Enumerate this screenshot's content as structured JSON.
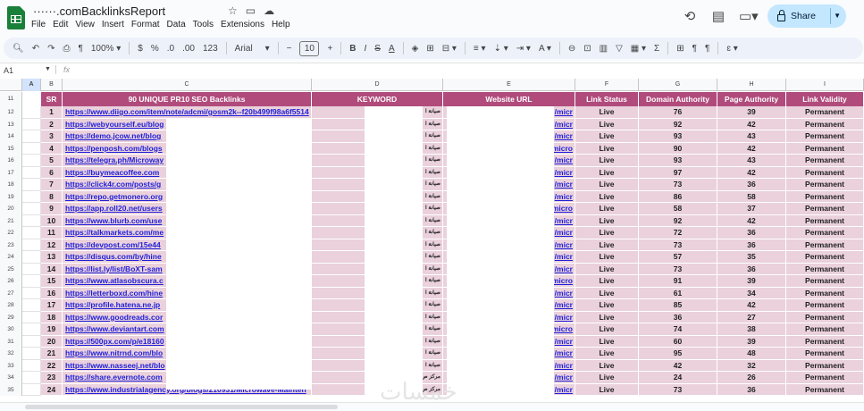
{
  "app": {
    "doc_title": "······.comBacklinksReport",
    "menu": [
      "File",
      "Edit",
      "View",
      "Insert",
      "Format",
      "Data",
      "Tools",
      "Extensions",
      "Help"
    ],
    "share_label": "Share",
    "title_icons": [
      "star-icon",
      "folder-move-icon",
      "cloud-status-icon"
    ],
    "top_right_icons": [
      "history-icon",
      "comment-icon",
      "video-meet-icon"
    ]
  },
  "toolbar": {
    "zoom": "100%",
    "currency": "$",
    "percent": "%",
    "dec_less": ".0",
    "dec_more": ".00",
    "number_format": "123",
    "font": "Arial",
    "font_size": "10",
    "minus": "−",
    "plus": "+"
  },
  "formula_bar": {
    "cell_ref": "A1",
    "fx": "fx"
  },
  "columns": [
    "A",
    "B",
    "C",
    "D",
    "E",
    "F",
    "G",
    "H",
    "I"
  ],
  "headers": {
    "sr": "SR",
    "backlinks": "90 UNIQUE PR10 SEO Backlinks",
    "keyword": "KEYWORD",
    "website": "Website URL",
    "status": "Link Status",
    "da": "Domain Authority",
    "pa": "Page Authority",
    "validity": "Link Validity"
  },
  "header_row_num": "11",
  "rows": [
    {
      "n": "12",
      "sr": "1",
      "url": "https://www.diigo.com/item/note/adcmi/gosm2k--f20b499f98a6f5514",
      "kw": "صيانة ا",
      "site": "/micr",
      "status": "Live",
      "da": "76",
      "pa": "39",
      "valid": "Permanent"
    },
    {
      "n": "13",
      "sr": "2",
      "url": "https://webyourself.eu/blog",
      "kw": "صيانة ا",
      "site": "/micr",
      "status": "Live",
      "da": "92",
      "pa": "42",
      "valid": "Permanent"
    },
    {
      "n": "14",
      "sr": "3",
      "url": "https://demo.jcow.net/blog",
      "kw": "صيانة ا",
      "site": "/micr",
      "status": "Live",
      "da": "93",
      "pa": "43",
      "valid": "Permanent"
    },
    {
      "n": "15",
      "sr": "4",
      "url": "https://penposh.com/blogs",
      "kw": "صيانة ا",
      "site": "/micro",
      "status": "Live",
      "da": "90",
      "pa": "42",
      "valid": "Permanent"
    },
    {
      "n": "16",
      "sr": "5",
      "url": "https://telegra.ph/Microway",
      "kw": "صيانة ا",
      "site": "/micr",
      "status": "Live",
      "da": "93",
      "pa": "43",
      "valid": "Permanent"
    },
    {
      "n": "17",
      "sr": "6",
      "url": "https://buymeacoffee.com",
      "kw": "صيانة ا",
      "site": "/micr",
      "status": "Live",
      "da": "97",
      "pa": "42",
      "valid": "Permanent"
    },
    {
      "n": "18",
      "sr": "7",
      "url": "https://click4r.com/posts/g",
      "kw": "صيانة ا",
      "site": "/micr",
      "status": "Live",
      "da": "73",
      "pa": "36",
      "valid": "Permanent"
    },
    {
      "n": "19",
      "sr": "8",
      "url": "https://repo.getmonero.org",
      "kw": "صيانة ا",
      "site": "/micr",
      "status": "Live",
      "da": "86",
      "pa": "58",
      "valid": "Permanent"
    },
    {
      "n": "20",
      "sr": "9",
      "url": "https://app.roll20.net/users",
      "kw": "صيانة ا",
      "site": "/micro",
      "status": "Live",
      "da": "58",
      "pa": "37",
      "valid": "Permanent"
    },
    {
      "n": "21",
      "sr": "10",
      "url": "https://www.blurb.com/use",
      "kw": "صيانة ا",
      "site": "/micr",
      "status": "Live",
      "da": "92",
      "pa": "42",
      "valid": "Permanent"
    },
    {
      "n": "22",
      "sr": "11",
      "url": "https://talkmarkets.com/me",
      "kw": "صيانة ا",
      "site": "/micr",
      "status": "Live",
      "da": "72",
      "pa": "36",
      "valid": "Permanent"
    },
    {
      "n": "23",
      "sr": "12",
      "url": "https://devpost.com/15e44",
      "kw": "صيانة ا",
      "site": "/micr",
      "status": "Live",
      "da": "73",
      "pa": "36",
      "valid": "Permanent"
    },
    {
      "n": "24",
      "sr": "13",
      "url": "https://disqus.com/by/hine",
      "kw": "صيانة ا",
      "site": "/micr",
      "status": "Live",
      "da": "57",
      "pa": "35",
      "valid": "Permanent"
    },
    {
      "n": "25",
      "sr": "14",
      "url": "https://list.ly/list/BoXT-sam",
      "kw": "صيانة ا",
      "site": "/micr",
      "status": "Live",
      "da": "73",
      "pa": "36",
      "valid": "Permanent"
    },
    {
      "n": "26",
      "sr": "15",
      "url": "https://www.atlasobscura.c",
      "kw": "صيانة ا",
      "site": "/micro",
      "status": "Live",
      "da": "91",
      "pa": "39",
      "valid": "Permanent"
    },
    {
      "n": "27",
      "sr": "16",
      "url": "https://letterboxd.com/hine",
      "kw": "صيانة ا",
      "site": "/micr",
      "status": "Live",
      "da": "61",
      "pa": "34",
      "valid": "Permanent"
    },
    {
      "n": "28",
      "sr": "17",
      "url": "https://profile.hatena.ne.jp",
      "kw": "صيانة ا",
      "site": "/micr",
      "status": "Live",
      "da": "85",
      "pa": "42",
      "valid": "Permanent"
    },
    {
      "n": "29",
      "sr": "18",
      "url": "https://www.goodreads.cor",
      "kw": "صيانة ا",
      "site": "/micr",
      "status": "Live",
      "da": "36",
      "pa": "27",
      "valid": "Permanent"
    },
    {
      "n": "30",
      "sr": "19",
      "url": "https://www.deviantart.com",
      "kw": "صيانة ا",
      "site": "/micro",
      "status": "Live",
      "da": "74",
      "pa": "38",
      "valid": "Permanent"
    },
    {
      "n": "31",
      "sr": "20",
      "url": "https://500px.com/p/e18160",
      "kw": "صيانة ا",
      "site": "/micr",
      "status": "Live",
      "da": "60",
      "pa": "39",
      "valid": "Permanent"
    },
    {
      "n": "32",
      "sr": "21",
      "url": "https://www.nitrnd.com/blo",
      "kw": "صيانة ا",
      "site": "/micr",
      "status": "Live",
      "da": "95",
      "pa": "48",
      "valid": "Permanent"
    },
    {
      "n": "33",
      "sr": "22",
      "url": "https://www.nasseej.net/blo",
      "kw": "صيانة ا",
      "site": "/micr",
      "status": "Live",
      "da": "42",
      "pa": "32",
      "valid": "Permanent"
    },
    {
      "n": "34",
      "sr": "23",
      "url": "https://share.evernote.com",
      "kw": "مركز ص",
      "site": "/micr",
      "status": "Live",
      "da": "24",
      "pa": "26",
      "valid": "Permanent"
    },
    {
      "n": "35",
      "sr": "24",
      "url": "https://www.industrialagency.org/blogs/210931/Microwave-Mainten",
      "kw": "مركز ص",
      "site": "/micr",
      "status": "Live",
      "da": "73",
      "pa": "36",
      "valid": "Permanent"
    }
  ],
  "colors": {
    "header_bg": "#b04b7c",
    "row_bg": "#ead1dc",
    "link": "#1f1fd8",
    "share_bg": "#c2e7ff"
  },
  "watermark": "خمسات"
}
